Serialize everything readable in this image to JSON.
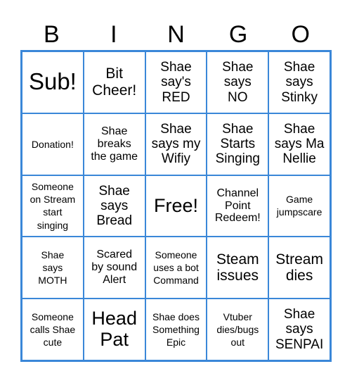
{
  "header": [
    "B",
    "I",
    "N",
    "G",
    "O"
  ],
  "accent_color": "#3a87d8",
  "cells": [
    {
      "text": "Sub!",
      "size": "s-xl"
    },
    {
      "text": "Bit\nCheer!",
      "size": "s-m"
    },
    {
      "text": "Shae\nsay's\nRED",
      "size": "s-n"
    },
    {
      "text": "Shae\nsays\nNO",
      "size": "s-n"
    },
    {
      "text": "Shae\nsays\nStinky",
      "size": "s-n"
    },
    {
      "text": "Donation!",
      "size": "s-xs"
    },
    {
      "text": "Shae\nbreaks\nthe game",
      "size": "s-s"
    },
    {
      "text": "Shae\nsays my\nWifiy",
      "size": "s-n"
    },
    {
      "text": "Shae\nStarts\nSinging",
      "size": "s-n"
    },
    {
      "text": "Shae\nsays Ma\nNellie",
      "size": "s-n"
    },
    {
      "text": "Someone\non Stream\nstart\nsinging",
      "size": "s-xs"
    },
    {
      "text": "Shae\nsays\nBread",
      "size": "s-n"
    },
    {
      "text": "Free!",
      "size": "s-l"
    },
    {
      "text": "Channel\nPoint\nRedeem!",
      "size": "s-s"
    },
    {
      "text": "Game\njumpscare",
      "size": "s-xs"
    },
    {
      "text": "Shae\nsays\nMOTH",
      "size": "s-xs"
    },
    {
      "text": "Scared\nby sound\nAlert",
      "size": "s-s"
    },
    {
      "text": "Someone\nuses a bot\nCommand",
      "size": "s-xs"
    },
    {
      "text": "Steam\nissues",
      "size": "s-m"
    },
    {
      "text": "Stream\ndies",
      "size": "s-m"
    },
    {
      "text": "Someone\ncalls Shae\ncute",
      "size": "s-xs"
    },
    {
      "text": "Head\nPat",
      "size": "s-l"
    },
    {
      "text": "Shae does\nSomething\nEpic",
      "size": "s-xs"
    },
    {
      "text": "Vtuber\ndies/bugs\nout",
      "size": "s-xs"
    },
    {
      "text": "Shae\nsays\nSENPAI",
      "size": "s-n"
    }
  ]
}
